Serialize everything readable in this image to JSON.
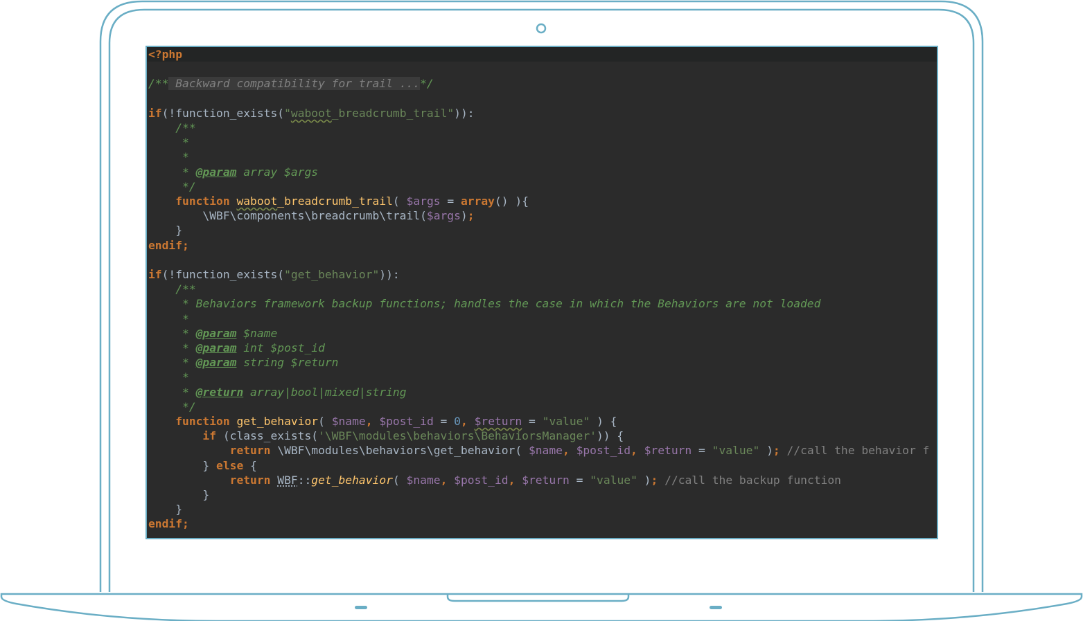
{
  "colors": {
    "frame": "#6aaec5",
    "editor_bg": "#2b2b2b",
    "keyword": "#cc7832",
    "string": "#6a8759",
    "variable": "#9876aa",
    "number": "#6897bb",
    "function": "#ffc66d",
    "doc_comment": "#629755",
    "comment": "#808080",
    "plain": "#a9b7c6"
  },
  "editor": {
    "lines": [
      {
        "highlight": true,
        "tokens": [
          {
            "t": "phptag",
            "v": "<?php"
          }
        ]
      },
      {
        "tokens": []
      },
      {
        "tokens": [
          {
            "t": "doc",
            "v": "/**"
          },
          {
            "t": "folded",
            "v": " Backward compatibility for trail ..."
          },
          {
            "t": "doc",
            "v": "*/"
          }
        ]
      },
      {
        "tokens": []
      },
      {
        "tokens": [
          {
            "t": "kw",
            "v": "if"
          },
          {
            "t": "plain",
            "v": "(!function_exists("
          },
          {
            "t": "str",
            "v": "\""
          },
          {
            "t": "str-wavy",
            "v": "waboot"
          },
          {
            "t": "str",
            "v": "_breadcrumb_trail\""
          },
          {
            "t": "plain",
            "v": ")):"
          }
        ]
      },
      {
        "tokens": [
          {
            "t": "plain",
            "v": "    "
          },
          {
            "t": "doc",
            "v": "/**"
          }
        ]
      },
      {
        "tokens": [
          {
            "t": "plain",
            "v": "     "
          },
          {
            "t": "doc",
            "v": "*"
          }
        ]
      },
      {
        "tokens": [
          {
            "t": "plain",
            "v": "     "
          },
          {
            "t": "doc",
            "v": "*"
          }
        ]
      },
      {
        "tokens": [
          {
            "t": "plain",
            "v": "     "
          },
          {
            "t": "doc",
            "v": "* "
          },
          {
            "t": "doctag",
            "v": "@param"
          },
          {
            "t": "doc",
            "v": " array $args"
          }
        ]
      },
      {
        "tokens": [
          {
            "t": "plain",
            "v": "     "
          },
          {
            "t": "doc",
            "v": "*/"
          }
        ]
      },
      {
        "tokens": [
          {
            "t": "plain",
            "v": "    "
          },
          {
            "t": "kw",
            "v": "function "
          },
          {
            "t": "fn-wavy",
            "v": "waboot"
          },
          {
            "t": "fn",
            "v": "_breadcrumb_trail"
          },
          {
            "t": "plain",
            "v": "( "
          },
          {
            "t": "var",
            "v": "$args"
          },
          {
            "t": "plain",
            "v": " = "
          },
          {
            "t": "kw",
            "v": "array"
          },
          {
            "t": "plain",
            "v": "() ){"
          }
        ]
      },
      {
        "tokens": [
          {
            "t": "plain",
            "v": "        \\WBF\\components\\breadcrumb\\trail("
          },
          {
            "t": "var",
            "v": "$args"
          },
          {
            "t": "plain",
            "v": ")"
          },
          {
            "t": "kw",
            "v": ";"
          }
        ]
      },
      {
        "tokens": [
          {
            "t": "plain",
            "v": "    }"
          }
        ]
      },
      {
        "tokens": [
          {
            "t": "kw",
            "v": "endif;"
          }
        ]
      },
      {
        "tokens": []
      },
      {
        "tokens": [
          {
            "t": "kw",
            "v": "if"
          },
          {
            "t": "plain",
            "v": "(!function_exists("
          },
          {
            "t": "str",
            "v": "\"get_behavior\""
          },
          {
            "t": "plain",
            "v": ")):"
          }
        ]
      },
      {
        "tokens": [
          {
            "t": "plain",
            "v": "    "
          },
          {
            "t": "doc",
            "v": "/**"
          }
        ]
      },
      {
        "tokens": [
          {
            "t": "plain",
            "v": "     "
          },
          {
            "t": "doc",
            "v": "* Behaviors framework backup functions; handles the case in which the Behaviors are not loaded"
          }
        ]
      },
      {
        "tokens": [
          {
            "t": "plain",
            "v": "     "
          },
          {
            "t": "doc",
            "v": "*"
          }
        ]
      },
      {
        "tokens": [
          {
            "t": "plain",
            "v": "     "
          },
          {
            "t": "doc",
            "v": "* "
          },
          {
            "t": "doctag",
            "v": "@param"
          },
          {
            "t": "doc",
            "v": " $name"
          }
        ]
      },
      {
        "tokens": [
          {
            "t": "plain",
            "v": "     "
          },
          {
            "t": "doc",
            "v": "* "
          },
          {
            "t": "doctag",
            "v": "@param"
          },
          {
            "t": "doc",
            "v": " int $post_id"
          }
        ]
      },
      {
        "tokens": [
          {
            "t": "plain",
            "v": "     "
          },
          {
            "t": "doc",
            "v": "* "
          },
          {
            "t": "doctag",
            "v": "@param"
          },
          {
            "t": "doc",
            "v": " string $return"
          }
        ]
      },
      {
        "tokens": [
          {
            "t": "plain",
            "v": "     "
          },
          {
            "t": "doc",
            "v": "*"
          }
        ]
      },
      {
        "tokens": [
          {
            "t": "plain",
            "v": "     "
          },
          {
            "t": "doc",
            "v": "* "
          },
          {
            "t": "doctag",
            "v": "@return"
          },
          {
            "t": "doc",
            "v": " array|bool|mixed|string"
          }
        ]
      },
      {
        "tokens": [
          {
            "t": "plain",
            "v": "     "
          },
          {
            "t": "doc",
            "v": "*/"
          }
        ]
      },
      {
        "tokens": [
          {
            "t": "plain",
            "v": "    "
          },
          {
            "t": "kw",
            "v": "function "
          },
          {
            "t": "fn",
            "v": "get_behavior"
          },
          {
            "t": "plain",
            "v": "( "
          },
          {
            "t": "var",
            "v": "$name"
          },
          {
            "t": "kw",
            "v": ", "
          },
          {
            "t": "var",
            "v": "$post_id"
          },
          {
            "t": "plain",
            "v": " = "
          },
          {
            "t": "num",
            "v": "0"
          },
          {
            "t": "kw",
            "v": ", "
          },
          {
            "t": "var-wavy",
            "v": "$return"
          },
          {
            "t": "plain",
            "v": " = "
          },
          {
            "t": "str",
            "v": "\"value\""
          },
          {
            "t": "plain",
            "v": " ) {"
          }
        ]
      },
      {
        "tokens": [
          {
            "t": "plain",
            "v": "        "
          },
          {
            "t": "kw",
            "v": "if"
          },
          {
            "t": "plain",
            "v": " (class_exists("
          },
          {
            "t": "str",
            "v": "'\\WBF\\modules\\behaviors\\BehaviorsManager'"
          },
          {
            "t": "plain",
            "v": ")) {"
          }
        ]
      },
      {
        "tokens": [
          {
            "t": "plain",
            "v": "            "
          },
          {
            "t": "kw",
            "v": "return "
          },
          {
            "t": "plain",
            "v": "\\WBF\\modules\\behaviors\\get_behavior( "
          },
          {
            "t": "var",
            "v": "$name"
          },
          {
            "t": "kw",
            "v": ", "
          },
          {
            "t": "var",
            "v": "$post_id"
          },
          {
            "t": "kw",
            "v": ", "
          },
          {
            "t": "var",
            "v": "$return"
          },
          {
            "t": "plain",
            "v": " = "
          },
          {
            "t": "str",
            "v": "\"value\""
          },
          {
            "t": "plain",
            "v": " )"
          },
          {
            "t": "kw",
            "v": "; "
          },
          {
            "t": "comment",
            "v": "//call the behavior f"
          }
        ]
      },
      {
        "tokens": [
          {
            "t": "plain",
            "v": "        } "
          },
          {
            "t": "kw",
            "v": "else"
          },
          {
            "t": "plain",
            "v": " {"
          }
        ]
      },
      {
        "tokens": [
          {
            "t": "plain",
            "v": "            "
          },
          {
            "t": "kw",
            "v": "return "
          },
          {
            "t": "plain-wavy",
            "v": "WBF"
          },
          {
            "t": "plain",
            "v": "::"
          },
          {
            "t": "fn-italic",
            "v": "get_behavior"
          },
          {
            "t": "plain",
            "v": "( "
          },
          {
            "t": "var",
            "v": "$name"
          },
          {
            "t": "kw",
            "v": ", "
          },
          {
            "t": "var",
            "v": "$post_id"
          },
          {
            "t": "kw",
            "v": ", "
          },
          {
            "t": "var",
            "v": "$return"
          },
          {
            "t": "plain",
            "v": " = "
          },
          {
            "t": "str",
            "v": "\"value\""
          },
          {
            "t": "plain",
            "v": " )"
          },
          {
            "t": "kw",
            "v": "; "
          },
          {
            "t": "comment",
            "v": "//call the backup function"
          }
        ]
      },
      {
        "tokens": [
          {
            "t": "plain",
            "v": "        }"
          }
        ]
      },
      {
        "tokens": [
          {
            "t": "plain",
            "v": "    }"
          }
        ]
      },
      {
        "tokens": [
          {
            "t": "kw",
            "v": "endif;"
          }
        ]
      }
    ]
  }
}
